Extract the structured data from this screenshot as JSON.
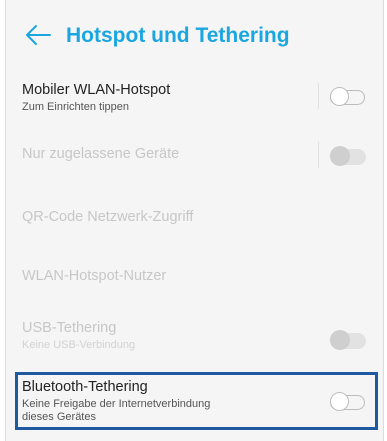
{
  "header": {
    "title": "Hotspot und Tethering",
    "back_icon": "arrow-left-icon"
  },
  "settings": [
    {
      "label": "Mobiler WLAN-Hotspot",
      "sub": "Zum Einrichten tippen",
      "toggle": "off",
      "enabled": true
    },
    {
      "label": "Nur zugelassene Geräte",
      "sub": "",
      "toggle": "off",
      "enabled": false
    },
    {
      "label": "QR-Code Netzwerk-Zugriff",
      "sub": "",
      "enabled": false
    },
    {
      "label": "WLAN-Hotspot-Nutzer",
      "sub": "",
      "enabled": false
    },
    {
      "label": "USB-Tethering",
      "sub": "Keine USB-Verbindung",
      "toggle": "off",
      "enabled": false
    },
    {
      "label": "Bluetooth-Tethering",
      "sub_line1": "Keine Freigabe der Internetverbindung",
      "sub_line2": "dieses Gerätes",
      "toggle": "off",
      "enabled": true,
      "highlighted": true
    }
  ],
  "colors": {
    "accent": "#1ca6e0",
    "highlight_border": "#1f5aa0"
  }
}
